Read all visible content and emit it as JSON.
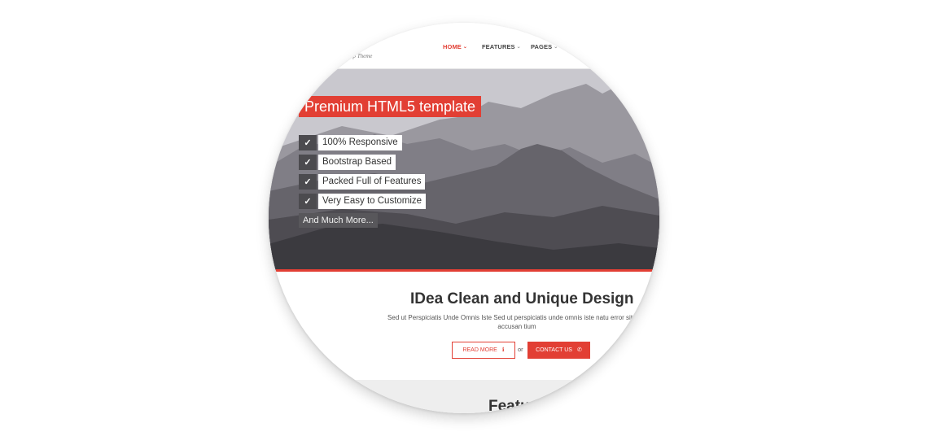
{
  "header": {
    "tagline": "ap Theme",
    "nav": [
      {
        "label": "HOME",
        "active": true
      },
      {
        "label": "FEATURES",
        "active": false
      },
      {
        "label": "PAGES",
        "active": false
      }
    ]
  },
  "hero": {
    "title": "Premium HTML5 template",
    "features": [
      "100% Responsive",
      "Bootstrap Based",
      "Packed Full of Features",
      "Very Easy to Customize"
    ],
    "more_label": "And Much More...",
    "check_glyph": "✓"
  },
  "intro": {
    "heading": "IDea Clean and Unique Design",
    "text": "Sed ut Perspiciatis Unde Omnis Iste Sed ut perspiciatis unde omnis iste natu error sit volu accusan tium",
    "read_more_label": "READ MORE",
    "or_label": "or",
    "contact_label": "CONTACT US"
  },
  "next_section": {
    "title": "Featu"
  },
  "colors": {
    "accent": "#e23f34",
    "dark": "#4c4b4f",
    "bg": "#ffffff"
  }
}
